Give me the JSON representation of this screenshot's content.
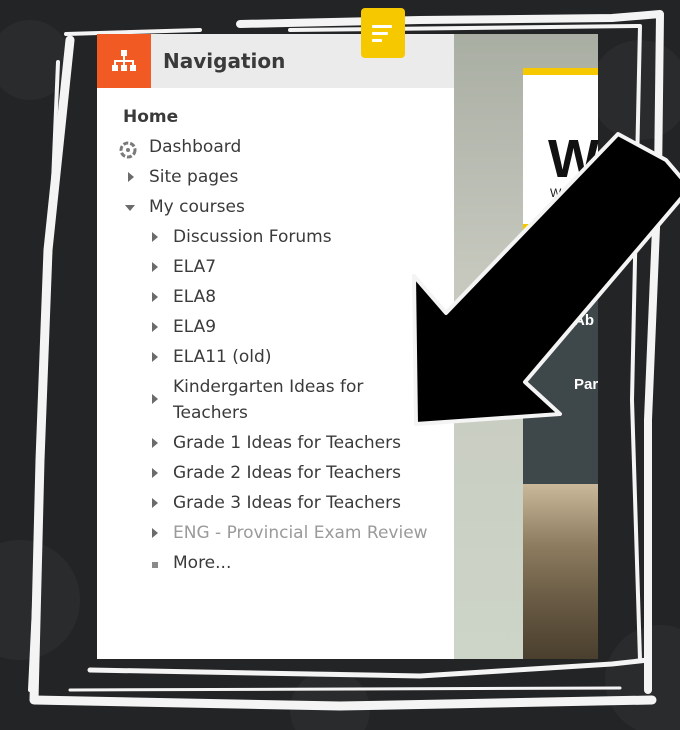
{
  "navigation": {
    "title": "Navigation",
    "home": "Home",
    "dashboard": "Dashboard",
    "site_pages": "Site pages",
    "my_courses": "My courses",
    "courses": [
      "Discussion Forums",
      "ELA7",
      "ELA8",
      "ELA9",
      "ELA11 (old)"
    ],
    "kindergarten": [
      "Kindergarten Ideas for",
      "Teachers"
    ],
    "grades": [
      "Grade 1 Ideas for Teachers",
      "Grade 2 Ideas for Teachers",
      "Grade 3 Ideas for Teachers"
    ],
    "eng_review": "ENG - Provincial Exam Review",
    "more": "More..."
  },
  "site": {
    "logo_big": "W",
    "logo_small": "Western",
    "menu_item_1": "Ab",
    "menu_item_2": "Par"
  },
  "colors": {
    "accent_orange": "#f15a22",
    "accent_yellow": "#f5c800",
    "background": "#222325"
  },
  "icons": {
    "nav_header": "sitemap-icon",
    "dashboard": "dashboard-icon",
    "menu": "hamburger-menu-icon",
    "arrow": "pointer-arrow"
  }
}
